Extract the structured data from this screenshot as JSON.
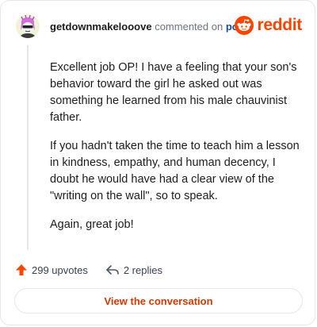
{
  "comment": {
    "username": "getdownmakelooove",
    "action_text": "commented on",
    "post_link": "post",
    "paragraphs": [
      "Excellent job OP! I have a feeling that your son's behavior toward the girl he asked out was something he learned from his male chauvinist father.",
      "If you hadn't taken the time to teach him a lesson in kindness, empathy, and human decency, I doubt he would have had a clear view of the \"writing on the wall\", so to speak.",
      "Again, great job!"
    ]
  },
  "brand": {
    "word": "reddit",
    "icon": "reddit-snoo-icon",
    "color": "#ff4500"
  },
  "stats": {
    "upvotes_label": "299 upvotes",
    "replies_label": "2 replies",
    "upvote_icon": "upvote-arrow-icon",
    "reply_icon": "reply-arrow-icon",
    "upvote_color": "#ff4500"
  },
  "cta": {
    "label": "View the conversation",
    "color": "#d43a00"
  }
}
